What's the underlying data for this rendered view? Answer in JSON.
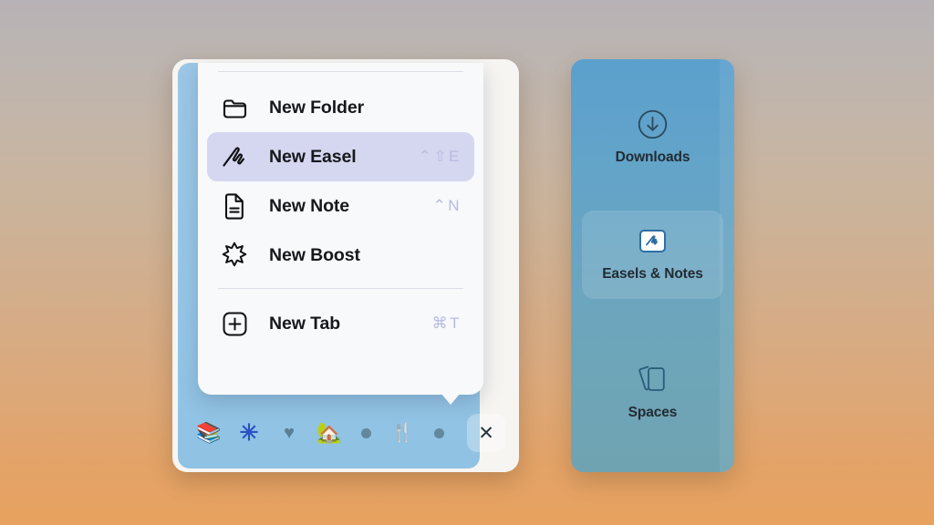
{
  "window": {
    "left_panel_name": "browser-sidebar",
    "right_panel_name": "spaces-sidebar"
  },
  "context_menu": {
    "groups": [
      {
        "items": [
          {
            "icon": "folder-icon",
            "label": "New Folder",
            "shortcut": "",
            "selected": false
          },
          {
            "icon": "scribble-icon",
            "label": "New Easel",
            "shortcut": "⌃⇧E",
            "selected": true
          },
          {
            "icon": "document-icon",
            "label": "New Note",
            "shortcut": "⌃N",
            "selected": false
          },
          {
            "icon": "sparkle-star-icon",
            "label": "New Boost",
            "shortcut": "",
            "selected": false
          }
        ]
      },
      {
        "items": [
          {
            "icon": "plus-square-icon",
            "label": "New Tab",
            "shortcut": "⌘T",
            "selected": false
          }
        ]
      }
    ]
  },
  "toolbar": {
    "items": [
      {
        "name": "books-icon",
        "glyph": "📚",
        "kind": "icon"
      },
      {
        "name": "asterisk-icon",
        "glyph": "✳",
        "kind": "icon"
      },
      {
        "name": "heart-icon",
        "glyph": "♥",
        "kind": "icon"
      },
      {
        "name": "house-with-garden-icon",
        "glyph": "🏡",
        "kind": "icon"
      },
      {
        "name": "dot-indicator",
        "glyph": "",
        "kind": "dot"
      },
      {
        "name": "fork-and-knife-icon",
        "glyph": "🍴",
        "kind": "icon"
      },
      {
        "name": "dot-indicator",
        "glyph": "",
        "kind": "dot"
      }
    ],
    "close_label": "✕"
  },
  "right_panel": {
    "items": [
      {
        "icon": "download-circle-icon",
        "label": "Downloads",
        "active": false
      },
      {
        "icon": "easel-badge-icon",
        "label": "Easels & Notes",
        "active": true
      },
      {
        "icon": "cards-stack-icon",
        "label": "Spaces",
        "active": false
      }
    ]
  },
  "colors": {
    "accent_blue": "#2d6ea3",
    "selected_row": "#d5d6ef",
    "shortcut_text": "#b7bbe0",
    "sidebar_blue": "#96c6e6",
    "panel_teal": "#6ba5bf",
    "background_top": "#b7b2b5",
    "background_bottom": "#e8a25f"
  }
}
